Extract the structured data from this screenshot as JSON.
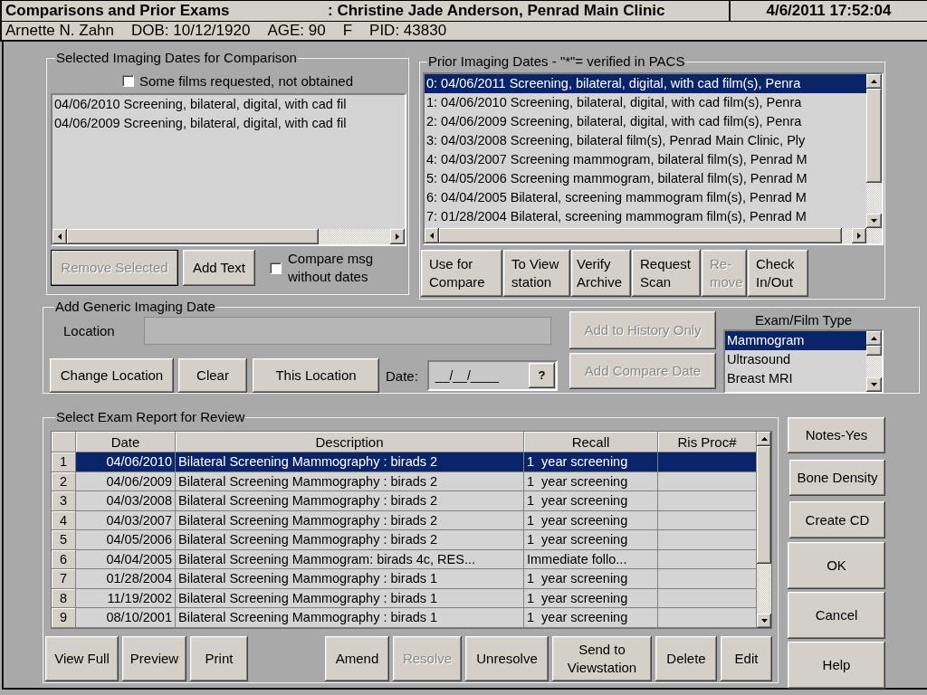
{
  "window": {
    "title": "Comparisons and Prior Exams",
    "subtitle": ": Christine Jade Anderson, Penrad Main Clinic",
    "datetime": "4/6/2011 17:52:04"
  },
  "patient": {
    "name": "Arnette N. Zahn",
    "dob": "DOB: 10/12/1920",
    "age": "AGE: 90",
    "sex": "F",
    "pid": "PID: 43830"
  },
  "selected_dates": {
    "title": "Selected Imaging Dates for Comparison",
    "films_checkbox": {
      "label": "Some films requested, not obtained",
      "checked": false
    },
    "items": [
      {
        "text": "04/06/2010 Screening, bilateral, digital, with cad fil",
        "selected": false
      },
      {
        "text": "04/06/2009 Screening, bilateral, digital, with cad fil",
        "selected": false
      }
    ],
    "buttons": [
      {
        "label": "Remove Selected",
        "disabled": true
      },
      {
        "label": "Add Text",
        "disabled": false
      }
    ],
    "compare_checkbox": {
      "label": "Compare msg without dates",
      "checked": false
    }
  },
  "prior_dates": {
    "title": "Prior Imaging Dates - \"*\"= verified in PACS",
    "items": [
      {
        "text": "0: 04/06/2011 Screening, bilateral, digital, with cad film(s), Penra",
        "selected": true
      },
      {
        "text": "1: 04/06/2010 Screening, bilateral, digital, with cad film(s), Penra",
        "selected": false
      },
      {
        "text": "2: 04/06/2009 Screening, bilateral, digital, with cad film(s), Penra",
        "selected": false
      },
      {
        "text": "3: 04/03/2008 Screening, bilateral film(s), Penrad Main Clinic, Ply",
        "selected": false
      },
      {
        "text": "4: 04/03/2007 Screening mammogram, bilateral film(s), Penrad M",
        "selected": false
      },
      {
        "text": "5: 04/05/2006 Screening mammogram, bilateral film(s), Penrad M",
        "selected": false
      },
      {
        "text": "6: 04/04/2005 Bilateral, screening mammogram film(s), Penrad M",
        "selected": false
      },
      {
        "text": "7: 01/28/2004 Bilateral, screening mammogram film(s), Penrad M",
        "selected": false
      }
    ],
    "buttons": [
      {
        "label": "Use for Compare",
        "disabled": false
      },
      {
        "label": "To View station",
        "disabled": false
      },
      {
        "label": "Verify Archive",
        "disabled": false
      },
      {
        "label": "Request Scan",
        "disabled": false
      },
      {
        "label": "Re-move",
        "disabled": true
      },
      {
        "label": "Check In/Out",
        "disabled": false
      }
    ]
  },
  "generic_date": {
    "title": "Add Generic Imaging Date",
    "location_label": "Location",
    "location_buttons": [
      {
        "label": "Change Location",
        "disabled": false
      },
      {
        "label": "Clear",
        "disabled": false
      },
      {
        "label": "This Location",
        "disabled": false
      }
    ],
    "date_label": "Date:",
    "date_value": "__/__/____",
    "date_help": "?",
    "side_buttons": [
      {
        "label": "Add to History Only",
        "disabled": true
      },
      {
        "label": "Add Compare Date",
        "disabled": true
      }
    ],
    "exam_type": {
      "label": "Exam/Film Type",
      "items": [
        {
          "text": "Mammogram",
          "selected": true
        },
        {
          "text": "Ultrasound",
          "selected": false
        },
        {
          "text": "Breast MRI",
          "selected": false
        }
      ]
    }
  },
  "report": {
    "title": "Select Exam Report for Review",
    "columns": [
      "Date",
      "Description",
      "Recall",
      "Ris Proc#"
    ],
    "rows": [
      {
        "number": "1",
        "date": "04/06/2010",
        "description": "Bilateral Screening Mammography : birads 2",
        "recall": "1  year screening",
        "selected": true
      },
      {
        "number": "2",
        "date": "04/06/2009",
        "description": "Bilateral Screening Mammography : birads 2",
        "recall": "1  year screening",
        "selected": false
      },
      {
        "number": "3",
        "date": "04/03/2008",
        "description": "Bilateral Screening Mammography : birads 2",
        "recall": "1  year screening",
        "selected": false
      },
      {
        "number": "4",
        "date": "04/03/2007",
        "description": "Bilateral Screening Mammography : birads 2",
        "recall": "1  year screening",
        "selected": false
      },
      {
        "number": "5",
        "date": "04/05/2006",
        "description": "Bilateral Screening Mammography : birads 2",
        "recall": "1  year screening",
        "selected": false
      },
      {
        "number": "6",
        "date": "04/04/2005",
        "description": "Bilateral Screening Mammogram: birads 4c, RES...",
        "recall": "Immediate follo...",
        "selected": false
      },
      {
        "number": "7",
        "date": "01/28/2004",
        "description": "Bilateral Screening Mammography : birads 1",
        "recall": "1  year screening",
        "selected": false
      },
      {
        "number": "8",
        "date": "11/19/2002",
        "description": "Bilateral Screening Mammography : birads 1",
        "recall": "1  year screening",
        "selected": false
      },
      {
        "number": "9",
        "date": "08/10/2001",
        "description": "Bilateral Screening Mammography : birads 1",
        "recall": "1  year screening",
        "selected": false
      }
    ],
    "left_buttons": [
      {
        "label": "View Full",
        "disabled": false
      },
      {
        "label": "Preview",
        "disabled": false
      },
      {
        "label": "Print",
        "disabled": false
      }
    ],
    "right_buttons": [
      {
        "label": "Amend",
        "disabled": false
      },
      {
        "label": "Resolve",
        "disabled": true
      },
      {
        "label": "Unresolve",
        "disabled": false
      },
      {
        "label": "Send to Viewstation",
        "disabled": false
      },
      {
        "label": "Delete",
        "disabled": false
      },
      {
        "label": "Edit",
        "disabled": false
      }
    ]
  },
  "side_buttons": [
    {
      "label": "Notes-Yes"
    },
    {
      "label": "Bone Density"
    },
    {
      "label": "Create CD"
    },
    {
      "label": "OK"
    },
    {
      "label": "Cancel"
    },
    {
      "label": "Help"
    }
  ]
}
